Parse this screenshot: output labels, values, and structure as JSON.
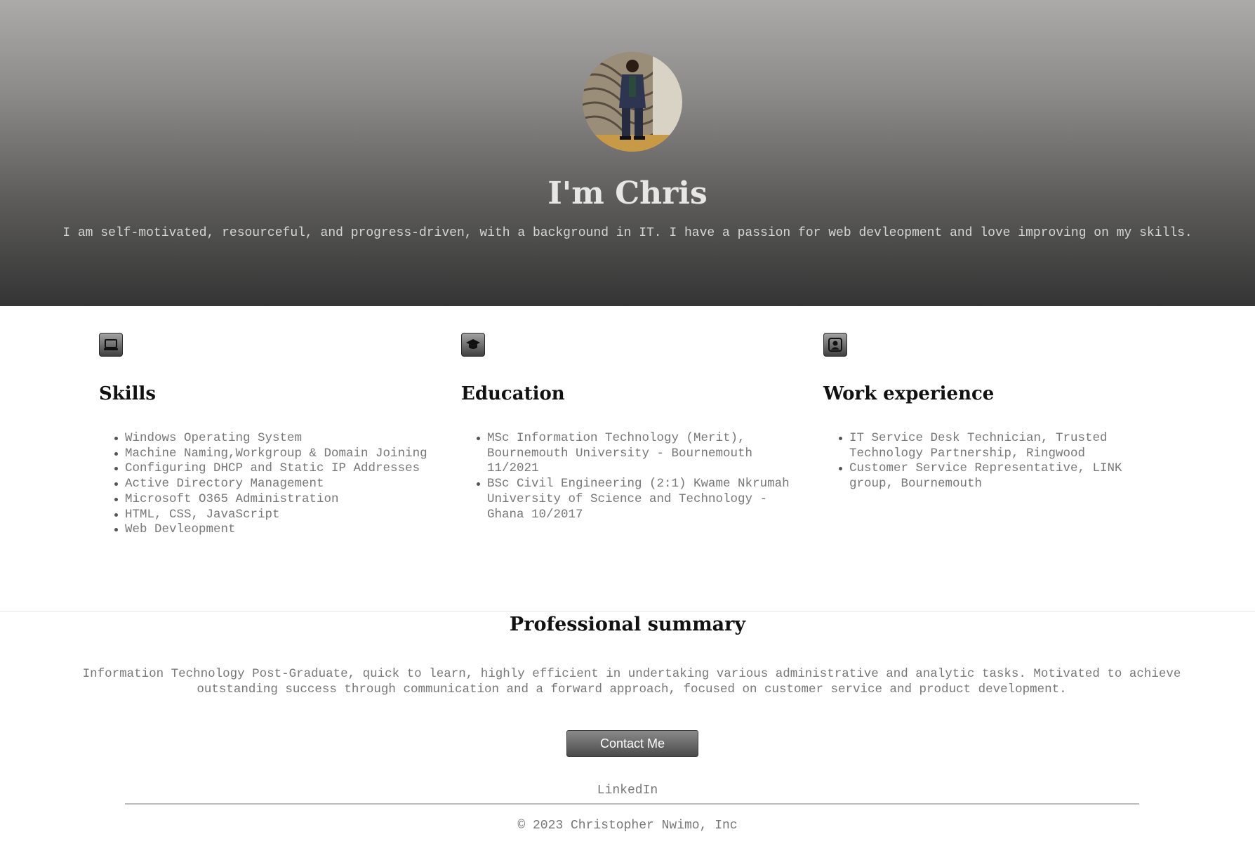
{
  "hero": {
    "title": "I'm Chris",
    "tagline": "I am self-motivated, resourceful, and progress-driven, with a background in IT. I have a passion for web devleopment and love improving on my skills."
  },
  "sections": {
    "skills": {
      "icon": "laptop-icon",
      "heading": "Skills",
      "items": [
        "Windows Operating System",
        "Machine Naming,Workgroup & Domain Joining",
        "Configuring DHCP and Static IP Addresses",
        "Active Directory Management",
        "Microsoft O365 Administration",
        "HTML, CSS, JavaScript",
        "Web Devleopment"
      ]
    },
    "education": {
      "icon": "graduation-cap-icon",
      "heading": "Education",
      "items": [
        "MSc Information Technology (Merit), Bournemouth University - Bournemouth 11/2021",
        "BSc Civil Engineering (2:1) Kwame Nkrumah University of Science and Technology - Ghana 10/2017"
      ]
    },
    "work": {
      "icon": "person-badge-icon",
      "heading": "Work experience",
      "items": [
        "IT Service Desk Technician, Trusted Technology Partnership, Ringwood",
        "Customer Service Representative, LINK group, Bournemouth"
      ]
    }
  },
  "summary": {
    "title": "Professional summary",
    "text": "Information Technology Post-Graduate, quick to learn, highly efficient in undertaking various administrative and analytic tasks. Motivated to achieve outstanding success through communication and a forward approach, focused on customer service and product development."
  },
  "contact_button": "Contact Me",
  "linkedin_link": "LinkedIn",
  "footer": {
    "copyright": "© 2023 Christopher Nwimo, Inc"
  },
  "colors": {
    "hero_top": "#acaaa9",
    "hero_bottom": "#343434",
    "heading": "#111111",
    "body_text": "#777777"
  }
}
